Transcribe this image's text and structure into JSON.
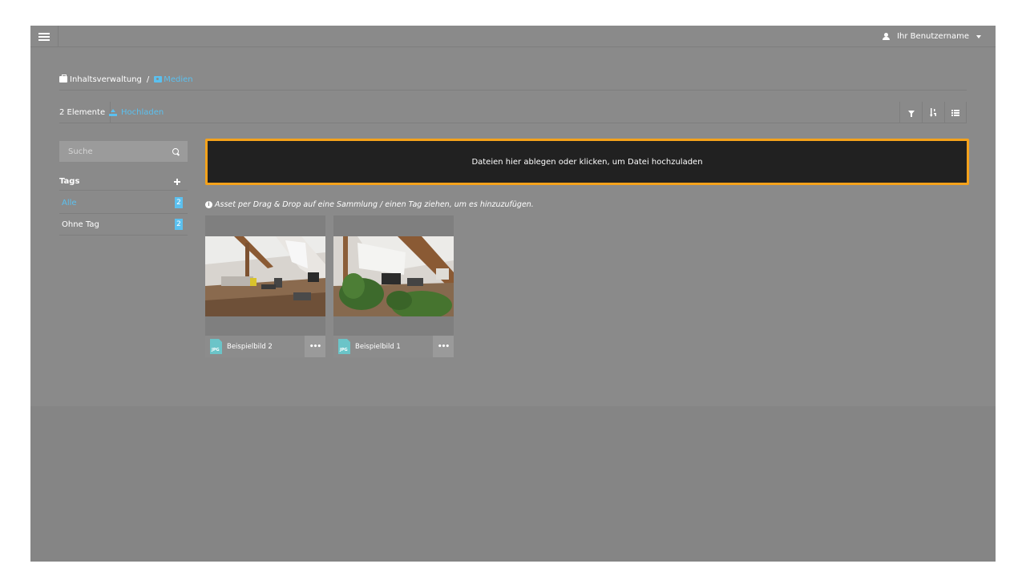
{
  "topbar": {
    "menu_icon": "hamburger-icon",
    "user_icon": "user-icon",
    "username": "Ihr Benutzername"
  },
  "breadcrumb": {
    "root_icon": "briefcase-icon",
    "root": "Inhaltsverwaltung",
    "separator": "/",
    "current_icon": "camera-icon",
    "current": "Medien"
  },
  "toolbar": {
    "count_label": "2 Elemente",
    "upload_label": "Hochladen",
    "buttons": [
      "filter-icon",
      "sort-icon",
      "list-view-icon"
    ]
  },
  "sidebar": {
    "search_placeholder": "Suche",
    "tags_heading": "Tags",
    "tags": [
      {
        "label": "Alle",
        "count": "2",
        "active": true
      },
      {
        "label": "Ohne Tag",
        "count": "2",
        "active": false
      }
    ]
  },
  "dropzone": {
    "text": "Dateien hier ablegen oder klicken, um Datei hochzuladen"
  },
  "hint": {
    "text": "Asset per Drag & Drop auf eine Sammlung / einen Tag ziehen, um es hinzuzufügen."
  },
  "assets": [
    {
      "name": "Beispielbild 2",
      "file_type": "JPG",
      "more": "•••"
    },
    {
      "name": "Beispielbild 1",
      "file_type": "JPG",
      "more": "•••"
    }
  ],
  "colors": {
    "accent": "#5bc0ef",
    "dropzone_border": "#f5a21b",
    "dropzone_bg": "#212121",
    "overlay_bg": "#8a8a8a"
  }
}
